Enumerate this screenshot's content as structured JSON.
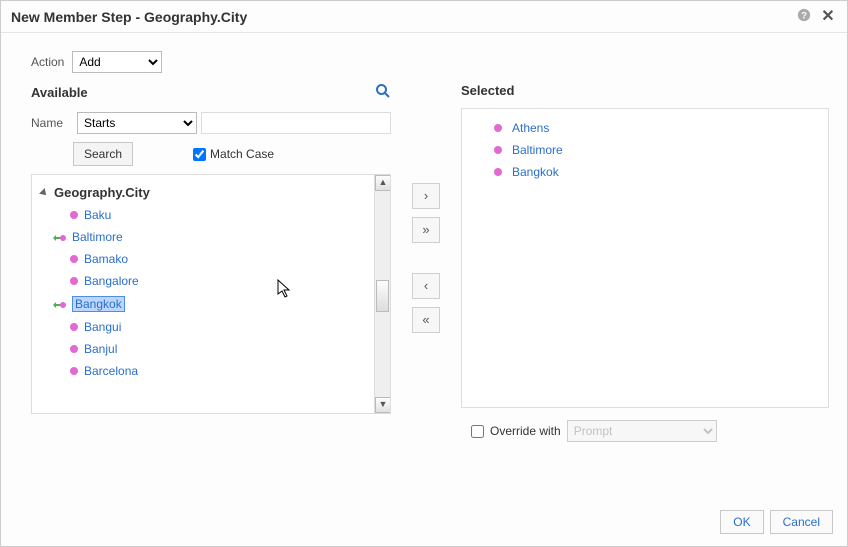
{
  "dialog": {
    "title": "New Member Step - Geography.City"
  },
  "action": {
    "label": "Action",
    "value": "Add"
  },
  "available": {
    "header": "Available",
    "name_label": "Name",
    "name_filter": "Starts",
    "name_value": "",
    "search_btn": "Search",
    "match_case_label": "Match Case",
    "match_case_checked": true,
    "root_label": "Geography.City",
    "items": [
      {
        "label": "Baku",
        "moved": false,
        "highlight": false
      },
      {
        "label": "Baltimore",
        "moved": true,
        "highlight": false
      },
      {
        "label": "Bamako",
        "moved": false,
        "highlight": false
      },
      {
        "label": "Bangalore",
        "moved": false,
        "highlight": false
      },
      {
        "label": "Bangkok",
        "moved": true,
        "highlight": true
      },
      {
        "label": "Bangui",
        "moved": false,
        "highlight": false
      },
      {
        "label": "Banjul",
        "moved": false,
        "highlight": false
      },
      {
        "label": "Barcelona",
        "moved": false,
        "highlight": false
      }
    ]
  },
  "selected": {
    "header": "Selected",
    "items": [
      {
        "label": "Athens"
      },
      {
        "label": "Baltimore"
      },
      {
        "label": "Bangkok"
      }
    ]
  },
  "override": {
    "label": "Override with",
    "checked": false,
    "value": "Prompt"
  },
  "buttons": {
    "ok": "OK",
    "cancel": "Cancel"
  },
  "transfer": {
    "add": "›",
    "add_all": "»",
    "remove": "‹",
    "remove_all": "«"
  }
}
